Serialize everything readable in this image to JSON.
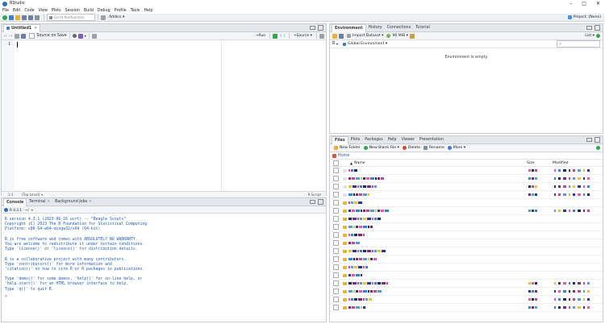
{
  "window": {
    "app_icon": "r-logo-icon",
    "title": "RStudio"
  },
  "menubar": [
    "File",
    "Edit",
    "Code",
    "View",
    "Plots",
    "Session",
    "Build",
    "Debug",
    "Profile",
    "Tools",
    "Help"
  ],
  "main_toolbar": {
    "goto_placeholder": "Go to file/function",
    "addins": "Addins",
    "project": "Project: (None)"
  },
  "editor": {
    "tab_label": "Untitled1",
    "source_on_save": "Source on Save",
    "run": "Run",
    "source": "Source",
    "line_number": "1",
    "status_position": "1:1",
    "status_scope": "(Top Level)",
    "status_type": "R Script"
  },
  "console_pane": {
    "tabs": [
      "Console",
      "Terminal",
      "Background Jobs"
    ],
    "r_version": "R 4.3.1 · ~/",
    "lines": [
      "R version 4.3.1 (2023-06-16 ucrt) -- \"Beagle Scouts\"",
      "Copyright (C) 2023 The R Foundation for Statistical Computing",
      "Platform: x86_64-w64-mingw32/x64 (64-bit)",
      "",
      "R is free software and comes with ABSOLUTELY NO WARRANTY.",
      "You are welcome to redistribute it under certain conditions.",
      "Type 'license()' or 'licence()' for distribution details.",
      "",
      "R is a collaborative project with many contributors.",
      "Type 'contributors()' for more information and",
      "'citation()' on how to cite R or R packages in publications.",
      "",
      "Type 'demo()' for some demos, 'help()' for on-line help, or",
      "'help.start()' for an HTML browser interface to help.",
      "Type 'q()' to quit R."
    ],
    "prompt": ">"
  },
  "env_pane": {
    "tabs": [
      "Environment",
      "History",
      "Connections",
      "Tutorial"
    ],
    "import_dataset": "Import Dataset",
    "memory": "96 MiB",
    "list_view": "List",
    "lang": "R",
    "scope": "Global Environment",
    "empty_message": "Environment is empty"
  },
  "files_pane": {
    "tabs": [
      "Files",
      "Plots",
      "Packages",
      "Help",
      "Viewer",
      "Presentation"
    ],
    "toolbar": [
      "New Folder",
      "New Blank File",
      "Delete",
      "Rename",
      "More"
    ],
    "path": "Home",
    "columns": {
      "name": "Name",
      "size": "Size",
      "modified": "Modified"
    }
  },
  "colors": {
    "accent": "#3b7ddd",
    "chrome": "#e4e8ec",
    "pane_header": "#eef1f4",
    "console_blue": "#1f5dbb"
  }
}
